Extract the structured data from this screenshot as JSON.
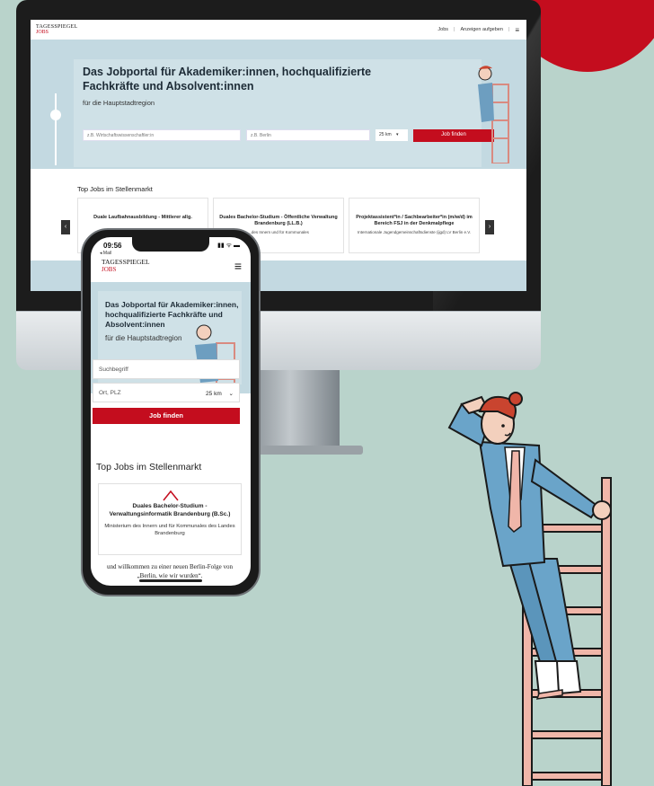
{
  "desktop": {
    "logo_top": "TAGESSPIEGEL",
    "logo_bottom": "JOBS",
    "nav_jobs": "Jobs",
    "nav_sep1": "|",
    "nav_post": "Anzeigen aufgeben",
    "nav_sep2": "|",
    "hero_title": "Das Jobportal für Akademiker:innen, hochqualifizierte Fachkräfte und Absolvent:innen",
    "hero_subtitle": "für die Hauptstadtregion",
    "search_placeholder": "z.B. Wirtschaftswissenschaftler:in",
    "location_placeholder": "z.B. Berlin",
    "radius": "25 km",
    "search_button": "Job finden",
    "top_jobs_label": "Top Jobs im Stellenmarkt",
    "cards": [
      {
        "title": "Duale Laufbahnausbildung - Mittlerer allg.",
        "company": ""
      },
      {
        "title": "Duales Bachelor-Studium - Öffentliche Verwaltung Brandenburg (LL.B.)",
        "company": "...des Innern und für Kommunales"
      },
      {
        "title": "Projektassistent*in / Sachbearbeiter*in (m/w/d) im Bereich FSJ in der Denkmalpflege",
        "company": "Internationale Jugendgemeinschaftsdienste (ijgd) LV Berlin e.V."
      }
    ]
  },
  "phone": {
    "time": "09:56",
    "back_label": "◂ Mail",
    "status_icons": "▮▮ ᯤ ▬",
    "logo_top": "TAGESSPIEGEL",
    "logo_bottom": "JOBS",
    "hero_title": "Das Jobportal für Akademiker:innen, hochqualifizierte Fachkräfte und Absolvent:innen",
    "hero_subtitle": "für die Hauptstadtregion",
    "search_placeholder": "Suchbegriff",
    "location_placeholder": "Ort, PLZ",
    "radius": "25 km",
    "search_button": "Job finden",
    "top_jobs_label": "Top Jobs im Stellenmarkt",
    "card_title": "Duales Bachelor-Studium - Verwaltungsinformatik Brandenburg (B.Sc.)",
    "card_company": "Ministerium des Innern und für Kommunales des Landes Brandenburg",
    "footer_text": "und willkommen zu einer neuen Berlin-Folge von „Berlin, wie wir wurden“."
  },
  "colors": {
    "background": "#b9d3cb",
    "brand_red": "#c40d1e",
    "hero_blue": "#c3d9e1"
  }
}
